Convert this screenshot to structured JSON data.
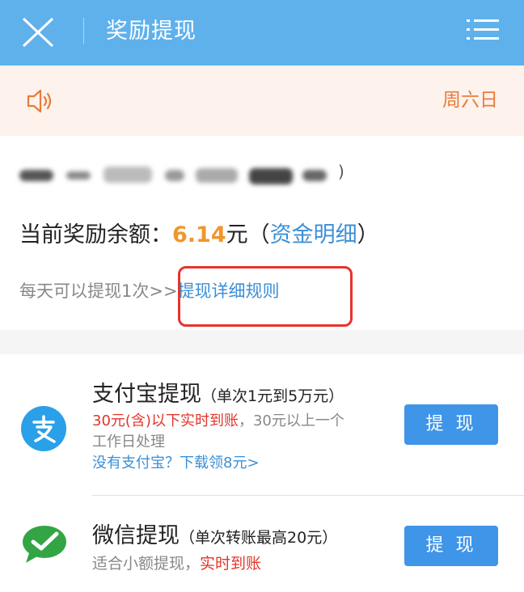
{
  "header": {
    "close_icon": "close-icon",
    "title": "奖励提现",
    "menu_icon": "list-menu-icon"
  },
  "notice": {
    "icon": "speaker-icon",
    "text": "周六日"
  },
  "account": {
    "text_suffix": ")",
    "note": "obscured account name and ID"
  },
  "balance": {
    "label": "当前奖励余额：",
    "amount": "6.14",
    "unit": "元（",
    "details_link": "资金明细",
    "close_paren": "）"
  },
  "rule": {
    "text": "每天可以提现1次>>",
    "link": "提现详细规则"
  },
  "alipay": {
    "icon": "alipay-icon",
    "title": "支付宝提现",
    "subtitle": "（单次1元到5万元）",
    "line1_red": "30元(含)以下实时到账",
    "line1_gray": "，30元以上一个",
    "line2": "工作日处理",
    "link": "没有支付宝？下载领8元>",
    "button": "提 现"
  },
  "wechat": {
    "icon": "wechat-icon",
    "title": "微信提现",
    "subtitle_pre": "（单次转账最高",
    "subtitle_red": "20元",
    "subtitle_post": "）",
    "line_gray": "适合小额提现，",
    "line_red": "实时到账",
    "button": "提 现"
  },
  "colors": {
    "header_bg": "#5fb1ec",
    "notice_bg": "#fdf2ec",
    "notice_text": "#e87b3c",
    "amount": "#f0962c",
    "link": "#3c8fd6",
    "red": "#e0352b",
    "button": "#3f95e8",
    "highlight_box": "#e8332a"
  }
}
